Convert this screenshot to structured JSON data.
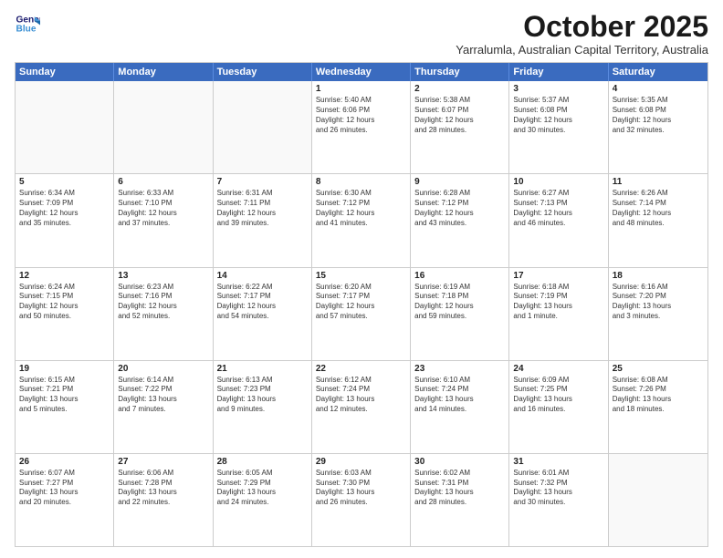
{
  "logo": {
    "line1": "General",
    "line2": "Blue"
  },
  "title": "October 2025",
  "subtitle": "Yarralumla, Australian Capital Territory, Australia",
  "dayHeaders": [
    "Sunday",
    "Monday",
    "Tuesday",
    "Wednesday",
    "Thursday",
    "Friday",
    "Saturday"
  ],
  "weeks": [
    [
      {
        "num": "",
        "info": ""
      },
      {
        "num": "",
        "info": ""
      },
      {
        "num": "",
        "info": ""
      },
      {
        "num": "1",
        "info": "Sunrise: 5:40 AM\nSunset: 6:06 PM\nDaylight: 12 hours\nand 26 minutes."
      },
      {
        "num": "2",
        "info": "Sunrise: 5:38 AM\nSunset: 6:07 PM\nDaylight: 12 hours\nand 28 minutes."
      },
      {
        "num": "3",
        "info": "Sunrise: 5:37 AM\nSunset: 6:08 PM\nDaylight: 12 hours\nand 30 minutes."
      },
      {
        "num": "4",
        "info": "Sunrise: 5:35 AM\nSunset: 6:08 PM\nDaylight: 12 hours\nand 32 minutes."
      }
    ],
    [
      {
        "num": "5",
        "info": "Sunrise: 6:34 AM\nSunset: 7:09 PM\nDaylight: 12 hours\nand 35 minutes."
      },
      {
        "num": "6",
        "info": "Sunrise: 6:33 AM\nSunset: 7:10 PM\nDaylight: 12 hours\nand 37 minutes."
      },
      {
        "num": "7",
        "info": "Sunrise: 6:31 AM\nSunset: 7:11 PM\nDaylight: 12 hours\nand 39 minutes."
      },
      {
        "num": "8",
        "info": "Sunrise: 6:30 AM\nSunset: 7:12 PM\nDaylight: 12 hours\nand 41 minutes."
      },
      {
        "num": "9",
        "info": "Sunrise: 6:28 AM\nSunset: 7:12 PM\nDaylight: 12 hours\nand 43 minutes."
      },
      {
        "num": "10",
        "info": "Sunrise: 6:27 AM\nSunset: 7:13 PM\nDaylight: 12 hours\nand 46 minutes."
      },
      {
        "num": "11",
        "info": "Sunrise: 6:26 AM\nSunset: 7:14 PM\nDaylight: 12 hours\nand 48 minutes."
      }
    ],
    [
      {
        "num": "12",
        "info": "Sunrise: 6:24 AM\nSunset: 7:15 PM\nDaylight: 12 hours\nand 50 minutes."
      },
      {
        "num": "13",
        "info": "Sunrise: 6:23 AM\nSunset: 7:16 PM\nDaylight: 12 hours\nand 52 minutes."
      },
      {
        "num": "14",
        "info": "Sunrise: 6:22 AM\nSunset: 7:17 PM\nDaylight: 12 hours\nand 54 minutes."
      },
      {
        "num": "15",
        "info": "Sunrise: 6:20 AM\nSunset: 7:17 PM\nDaylight: 12 hours\nand 57 minutes."
      },
      {
        "num": "16",
        "info": "Sunrise: 6:19 AM\nSunset: 7:18 PM\nDaylight: 12 hours\nand 59 minutes."
      },
      {
        "num": "17",
        "info": "Sunrise: 6:18 AM\nSunset: 7:19 PM\nDaylight: 13 hours\nand 1 minute."
      },
      {
        "num": "18",
        "info": "Sunrise: 6:16 AM\nSunset: 7:20 PM\nDaylight: 13 hours\nand 3 minutes."
      }
    ],
    [
      {
        "num": "19",
        "info": "Sunrise: 6:15 AM\nSunset: 7:21 PM\nDaylight: 13 hours\nand 5 minutes."
      },
      {
        "num": "20",
        "info": "Sunrise: 6:14 AM\nSunset: 7:22 PM\nDaylight: 13 hours\nand 7 minutes."
      },
      {
        "num": "21",
        "info": "Sunrise: 6:13 AM\nSunset: 7:23 PM\nDaylight: 13 hours\nand 9 minutes."
      },
      {
        "num": "22",
        "info": "Sunrise: 6:12 AM\nSunset: 7:24 PM\nDaylight: 13 hours\nand 12 minutes."
      },
      {
        "num": "23",
        "info": "Sunrise: 6:10 AM\nSunset: 7:24 PM\nDaylight: 13 hours\nand 14 minutes."
      },
      {
        "num": "24",
        "info": "Sunrise: 6:09 AM\nSunset: 7:25 PM\nDaylight: 13 hours\nand 16 minutes."
      },
      {
        "num": "25",
        "info": "Sunrise: 6:08 AM\nSunset: 7:26 PM\nDaylight: 13 hours\nand 18 minutes."
      }
    ],
    [
      {
        "num": "26",
        "info": "Sunrise: 6:07 AM\nSunset: 7:27 PM\nDaylight: 13 hours\nand 20 minutes."
      },
      {
        "num": "27",
        "info": "Sunrise: 6:06 AM\nSunset: 7:28 PM\nDaylight: 13 hours\nand 22 minutes."
      },
      {
        "num": "28",
        "info": "Sunrise: 6:05 AM\nSunset: 7:29 PM\nDaylight: 13 hours\nand 24 minutes."
      },
      {
        "num": "29",
        "info": "Sunrise: 6:03 AM\nSunset: 7:30 PM\nDaylight: 13 hours\nand 26 minutes."
      },
      {
        "num": "30",
        "info": "Sunrise: 6:02 AM\nSunset: 7:31 PM\nDaylight: 13 hours\nand 28 minutes."
      },
      {
        "num": "31",
        "info": "Sunrise: 6:01 AM\nSunset: 7:32 PM\nDaylight: 13 hours\nand 30 minutes."
      },
      {
        "num": "",
        "info": ""
      }
    ]
  ]
}
